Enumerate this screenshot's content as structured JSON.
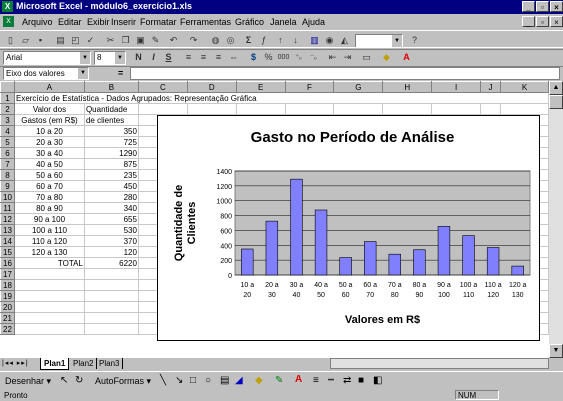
{
  "window": {
    "title": "Microsoft Excel - módulo6_exercício1.xls",
    "app_icon": "X",
    "controls": [
      "_",
      "▫",
      "×"
    ]
  },
  "menu": [
    "Arquivo",
    "Editar",
    "Exibir",
    "Inserir",
    "Formatar",
    "Ferramentas",
    "Gráfico",
    "Janela",
    "Ajuda"
  ],
  "toolbar": {
    "font_name": "Arial",
    "font_size": "8",
    "bold": "N",
    "italic": "I",
    "underline": "S",
    "zoom": "",
    "thousands": "000"
  },
  "formula_bar": {
    "name_box": "Eixo dos valores",
    "equals": "="
  },
  "sheet": {
    "columns": [
      "A",
      "B",
      "C",
      "D",
      "E",
      "F",
      "G",
      "H",
      "I",
      "J",
      "K"
    ],
    "title_row": "Exercício de Estatística - Dados Agrupados: Representação Gráfica",
    "header1": [
      "Valor dos",
      "Quantidade"
    ],
    "header2": [
      "Gastos (em R$)",
      "de clientes"
    ],
    "rows": [
      [
        "10 a 20",
        "350"
      ],
      [
        "20 a 30",
        "725"
      ],
      [
        "30 a 40",
        "1290"
      ],
      [
        "40 a 50",
        "875"
      ],
      [
        "50 a 60",
        "235"
      ],
      [
        "60 a 70",
        "450"
      ],
      [
        "70 a 80",
        "280"
      ],
      [
        "80 a 90",
        "340"
      ],
      [
        "90 a 100",
        "655"
      ],
      [
        "100 a 110",
        "530"
      ],
      [
        "110 a 120",
        "370"
      ],
      [
        "120 a 130",
        "120"
      ]
    ],
    "total": [
      "TOTAL",
      "6220"
    ],
    "row_numbers": [
      "1",
      "2",
      "3",
      "4",
      "5",
      "6",
      "7",
      "8",
      "9",
      "10",
      "11",
      "12",
      "13",
      "14",
      "15",
      "16",
      "17",
      "18",
      "19",
      "20",
      "21",
      "22"
    ]
  },
  "chart_data": {
    "type": "bar",
    "title": "Gasto no Período de Análise",
    "xlabel": "Valores em R$",
    "ylabel": "Quantidade de Clientes",
    "categories": [
      "10 a 20",
      "20 a 30",
      "30 a 40",
      "40 a 50",
      "50 a 60",
      "60 a 70",
      "70 a 80",
      "80 a 90",
      "90 a 100",
      "100 a 110",
      "110 a 120",
      "120 a 130"
    ],
    "values": [
      350,
      725,
      1290,
      875,
      235,
      450,
      280,
      340,
      655,
      530,
      370,
      120
    ],
    "ylim": [
      0,
      1400
    ],
    "yticks": [
      "0",
      "200",
      "400",
      "600",
      "800",
      "1000",
      "1200",
      "1400"
    ],
    "grid": true,
    "bar_color": "#8080ff",
    "plot_bg": "#c0c0c0"
  },
  "sheet_tabs": [
    "Plan1",
    "Plan2",
    "Plan3"
  ],
  "drawing": {
    "draw_label": "Desenhar ▾",
    "autoshapes_label": "AutoFormas ▾"
  },
  "status": {
    "left": "Pronto",
    "num": "NUM"
  }
}
